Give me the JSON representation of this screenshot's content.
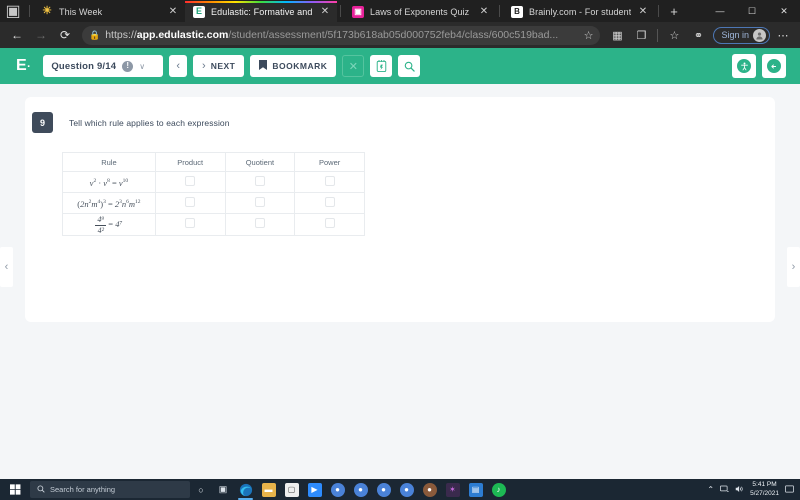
{
  "browser": {
    "tabs": [
      {
        "title": "This Week",
        "favicon": "sun-icon",
        "active": false
      },
      {
        "title": "Edulastic: Formative and Summa",
        "favicon": "edulastic-icon",
        "active": true
      },
      {
        "title": "Laws of Exponents Quiz",
        "favicon": "quiz-icon",
        "active": false
      },
      {
        "title": "Brainly.com - For students. By st",
        "favicon": "brainly-icon",
        "active": false
      }
    ],
    "new_tab_label": "+",
    "window_controls": {
      "minimize": "—",
      "maximize": "☐",
      "close": "✕"
    },
    "nav": {
      "back": "←",
      "forward": "→",
      "reload": "⟳"
    },
    "address": {
      "lock": "🔒",
      "scheme": "https://",
      "host": "app.edulastic.com",
      "path": "/student/assessment/5f173b618ab05d000752feb4/class/600c519bad...",
      "favorite_icon": "star-add-icon"
    },
    "toolbar_icons": [
      "collections-icon",
      "split-screen-icon",
      "favorites-icon",
      "browser-essentials-icon"
    ],
    "signin_label": "Sign in",
    "more_label": "⋯"
  },
  "app": {
    "brand": "E",
    "brand_dot": "·",
    "question_selector": {
      "label": "Question 9/14",
      "info_icon": "!",
      "caret": "∨"
    },
    "prev_label": "‹",
    "next": {
      "arrow": "›",
      "label": "NEXT"
    },
    "bookmark": {
      "icon": "🔖",
      "label": "BOOKMARK"
    },
    "close_icon": "✕",
    "calculator_icon": "calculator-icon",
    "magnify_icon": "🔍",
    "accessibility_icon": "☼",
    "exit_icon": "←"
  },
  "question": {
    "number": "9",
    "prompt": "Tell which rule applies to each expression",
    "table": {
      "headers": [
        "Rule",
        "Product",
        "Quotient",
        "Power"
      ],
      "rows": [
        {
          "rule_type": "inline",
          "parts": [
            {
              "t": "var",
              "v": "v"
            },
            {
              "t": "sup",
              "v": "2"
            },
            {
              "t": "op",
              "v": " · "
            },
            {
              "t": "var",
              "v": "v"
            },
            {
              "t": "sup",
              "v": "8"
            },
            {
              "t": "op",
              "v": " = "
            },
            {
              "t": "var",
              "v": "v"
            },
            {
              "t": "sup",
              "v": "10"
            }
          ],
          "checks": [
            false,
            false,
            false
          ]
        },
        {
          "rule_type": "inline",
          "parts": [
            {
              "t": "op",
              "v": "("
            },
            {
              "t": "num",
              "v": "2"
            },
            {
              "t": "var",
              "v": "n"
            },
            {
              "t": "sup",
              "v": "2"
            },
            {
              "t": "var",
              "v": "m"
            },
            {
              "t": "sup",
              "v": "4"
            },
            {
              "t": "op",
              "v": ")"
            },
            {
              "t": "sup",
              "v": "3"
            },
            {
              "t": "op",
              "v": " = "
            },
            {
              "t": "num",
              "v": "2"
            },
            {
              "t": "sup",
              "v": "3"
            },
            {
              "t": "var",
              "v": "n"
            },
            {
              "t": "sup",
              "v": "6"
            },
            {
              "t": "var",
              "v": "m"
            },
            {
              "t": "sup",
              "v": "12"
            }
          ],
          "checks": [
            false,
            false,
            false
          ]
        },
        {
          "rule_type": "fraction",
          "numerator": "4⁹",
          "denominator": "4²",
          "equals": " = ",
          "result": "4⁷",
          "checks": [
            false,
            false,
            false
          ]
        }
      ]
    }
  },
  "nav_arrows": {
    "left": "‹",
    "right": "›"
  },
  "taskbar": {
    "start_icon": "windows-icon",
    "search_placeholder": "Search for anything",
    "search_icon": "🔍",
    "task_view_icon": "▣",
    "cortana_icon": "○",
    "apps": [
      {
        "name": "edge",
        "glyph": "e",
        "bg": "#1b74bb",
        "active": true
      },
      {
        "name": "file-explorer",
        "glyph": "▭",
        "bg": "#e8b34a",
        "active": false
      },
      {
        "name": "microsoft-store",
        "glyph": "🛍",
        "bg": "#e9e9e9",
        "active": false
      },
      {
        "name": "zoom",
        "glyph": "■",
        "bg": "#2d8cff",
        "active": false
      },
      {
        "name": "chrome-1",
        "glyph": "◯",
        "bg": "#4a82d8",
        "active": false
      },
      {
        "name": "chrome-2",
        "glyph": "◯",
        "bg": "#4a82d8",
        "active": false
      },
      {
        "name": "chrome-3",
        "glyph": "◯",
        "bg": "#4a82d8",
        "active": false
      },
      {
        "name": "chrome-4",
        "glyph": "◯",
        "bg": "#4a82d8",
        "active": false
      },
      {
        "name": "profile-app",
        "glyph": "●",
        "bg": "#8a5a3b",
        "active": false
      },
      {
        "name": "purple-app",
        "glyph": "✶",
        "bg": "#3a2a4d",
        "active": false
      },
      {
        "name": "photos-app",
        "glyph": "▤",
        "bg": "#2d7dd2",
        "active": false
      },
      {
        "name": "spotify",
        "glyph": "♫",
        "bg": "#1db954",
        "active": false
      }
    ],
    "tray": {
      "chevron": "⌃",
      "network_icon": "🖵",
      "volume_icon": "🔊",
      "action_center_icon": "🖥"
    },
    "clock": {
      "time": "5:41 PM",
      "date": "5/27/2021"
    }
  },
  "colors": {
    "accent": "#2cb389",
    "tab_accent": "#ff8a00",
    "page_bg": "#f4f6f8",
    "taskbar": "#1b2733"
  }
}
